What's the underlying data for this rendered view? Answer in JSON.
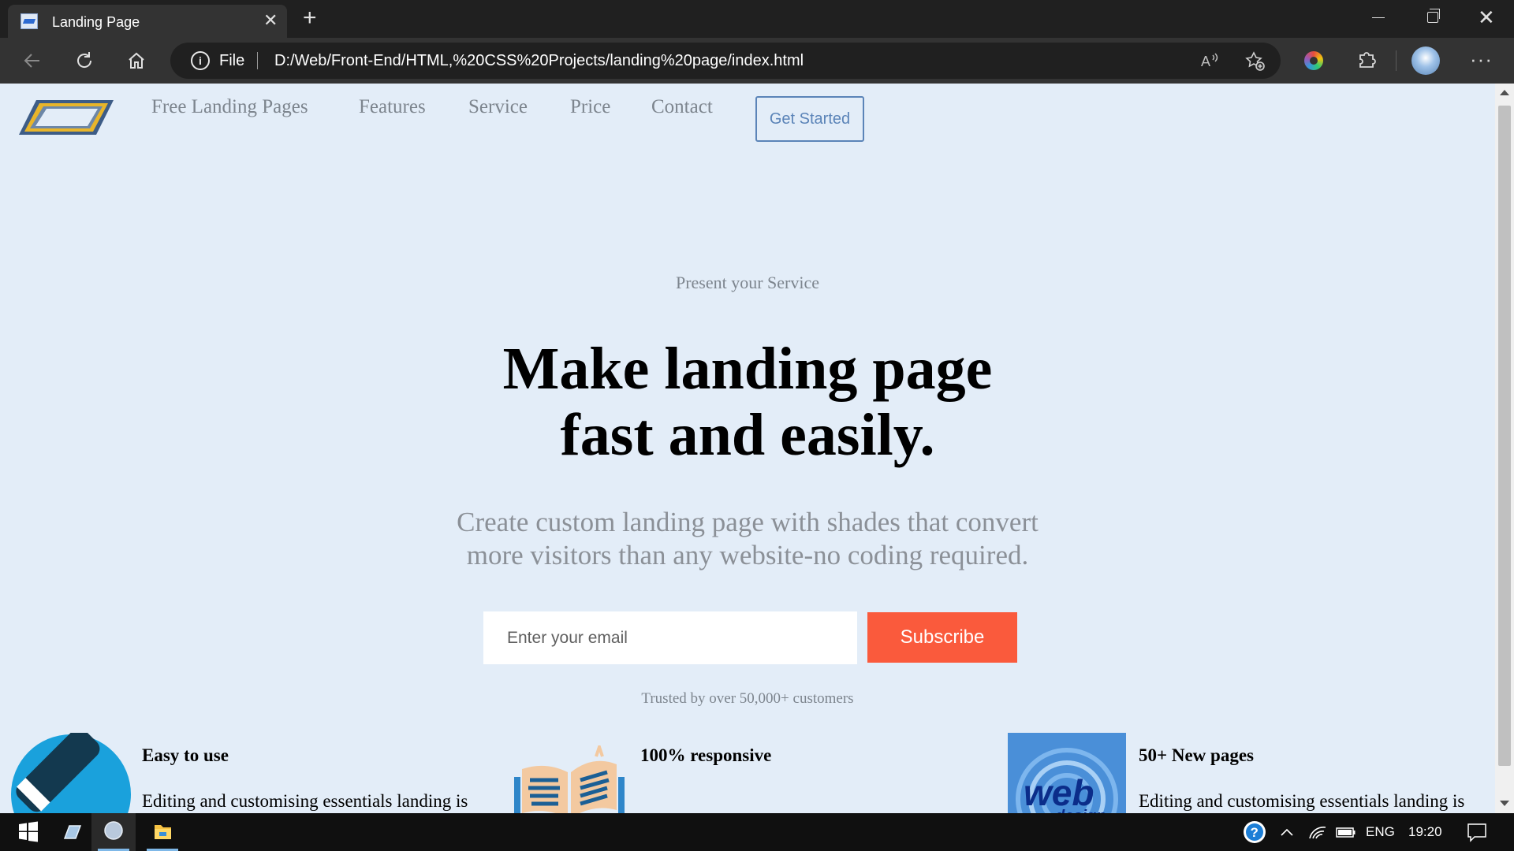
{
  "browser": {
    "tab_title": "Landing Page",
    "tab_close": "✕",
    "new_tab": "+",
    "address_scheme": "File",
    "address_url": "D:/Web/Front-End/HTML,%20CSS%20Projects/landing%20page/index.html",
    "window_close": "✕",
    "more": "···"
  },
  "nav": {
    "links": [
      "Free Landing Pages",
      "Features",
      "Service",
      "Price",
      "Contact"
    ],
    "cta": "Get Started"
  },
  "hero": {
    "eyebrow": "Present your Service",
    "headline_line1": "Make landing page",
    "headline_line2": "fast and easily.",
    "sub_line1": "Create custom landing page with shades that convert",
    "sub_line2": "more visitors than any website-no coding required.",
    "email_placeholder": "Enter your email",
    "subscribe_label": "Subscribe",
    "trusted": "Trusted by over 50,000+ customers"
  },
  "features": [
    {
      "title": "Easy to use",
      "text": "Editing and customising essentials landing is"
    },
    {
      "title": "100% responsive",
      "text": ""
    },
    {
      "title": "50+ New pages",
      "text": "Editing and customising essentials landing is"
    }
  ],
  "taskbar": {
    "lang": "ENG",
    "time": "19:20"
  },
  "icons": {
    "back": "back-arrow-icon",
    "refresh": "refresh-icon",
    "home": "home-icon",
    "info": "info-icon",
    "read_aloud": "read-aloud-icon",
    "favorites": "favorites-icon",
    "extensions": "puzzle-icon",
    "windows": "windows-start-icon",
    "help": "help-icon",
    "wifi": "wifi-icon",
    "battery": "battery-icon",
    "notifications": "notification-icon"
  },
  "colors": {
    "page_bg": "#e3edf8",
    "accent_button": "#fa5a3c",
    "cta_border": "#5b84b8",
    "muted_text": "#7d858e"
  }
}
